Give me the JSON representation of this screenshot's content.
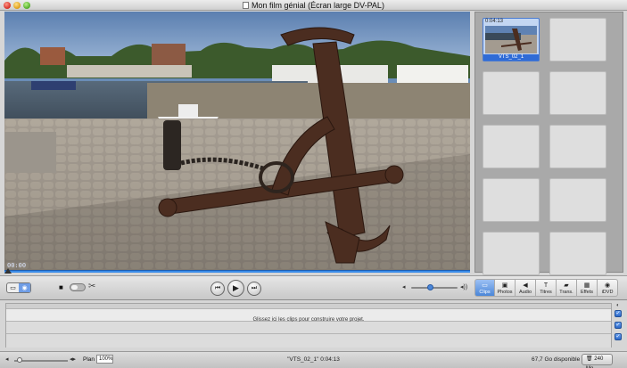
{
  "window": {
    "title": "Mon film génial (Écran large DV-PAL)"
  },
  "viewer": {
    "timecode": "00:00"
  },
  "clips_pane": {
    "clips": [
      {
        "duration": "0:04:13",
        "name": "VTS_02_1"
      }
    ],
    "empty_slots": 9
  },
  "controls": {
    "mode_toggle": {
      "left": "camera",
      "right": "edit"
    },
    "prev_label": "⏮",
    "play_label": "▶",
    "next_label": "⏭",
    "volume_level": 0.4
  },
  "panes": [
    {
      "label": "Clips",
      "icon": "clips-icon",
      "glyph": "▭"
    },
    {
      "label": "Photos",
      "icon": "photos-icon",
      "glyph": "▣"
    },
    {
      "label": "Audio",
      "icon": "audio-icon",
      "glyph": "◀"
    },
    {
      "label": "Titres",
      "icon": "titles-icon",
      "glyph": "T"
    },
    {
      "label": "Trans.",
      "icon": "transitions-icon",
      "glyph": "▰"
    },
    {
      "label": "Effets",
      "icon": "effects-icon",
      "glyph": "▦"
    },
    {
      "label": "iDVD",
      "icon": "idvd-icon",
      "glyph": "◉"
    }
  ],
  "timeline": {
    "drop_message": "Glissez ici les clips pour construire votre projet."
  },
  "status": {
    "plan_label": "Plan",
    "plan_value": "100%",
    "selected_info": "\"VTS_02_1\"   0:04:13",
    "disk_space": "67,7 Go disponible",
    "trash_label": "240 Mo"
  },
  "colors": {
    "selection_blue": "#4b86d8",
    "scrubber_blue": "#3b8ce8"
  }
}
